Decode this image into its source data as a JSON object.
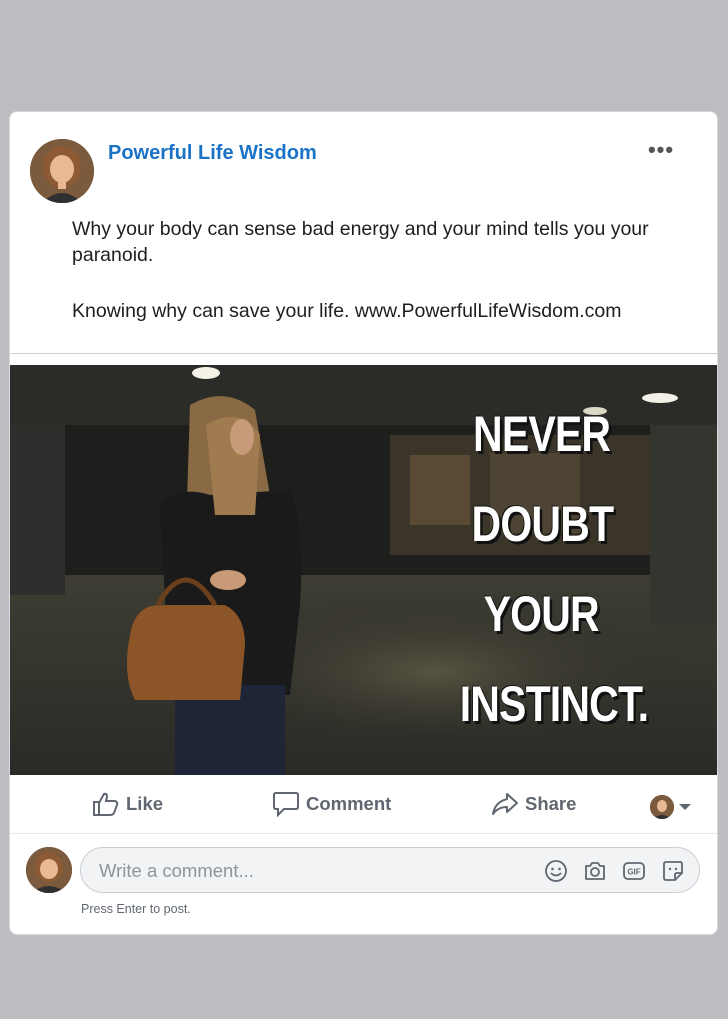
{
  "post": {
    "author": "Powerful Life Wisdom",
    "more_label": "•••",
    "text_paragraphs": [
      "Why your body can sense bad energy and your mind tells you your paranoid.",
      "Knowing why can save your life. www.PowerfulLifeWisdom.com"
    ],
    "image_overlay_lines": [
      "NEVER",
      "DOUBT",
      "YOUR",
      "INSTINCT."
    ]
  },
  "actions": {
    "like_label": "Like",
    "comment_label": "Comment",
    "share_label": "Share"
  },
  "comment": {
    "placeholder": "Write a comment...",
    "hint": "Press Enter to post."
  },
  "icons": {
    "like": "thumbs-up-icon",
    "comment": "speech-bubble-icon",
    "share": "share-arrow-icon",
    "emoji": "smiley-icon",
    "camera": "camera-icon",
    "gif": "gif-icon",
    "sticker": "sticker-icon"
  },
  "colors": {
    "author_link": "#1a73c6",
    "action_text": "#606770",
    "background": "#bcbdc0"
  }
}
